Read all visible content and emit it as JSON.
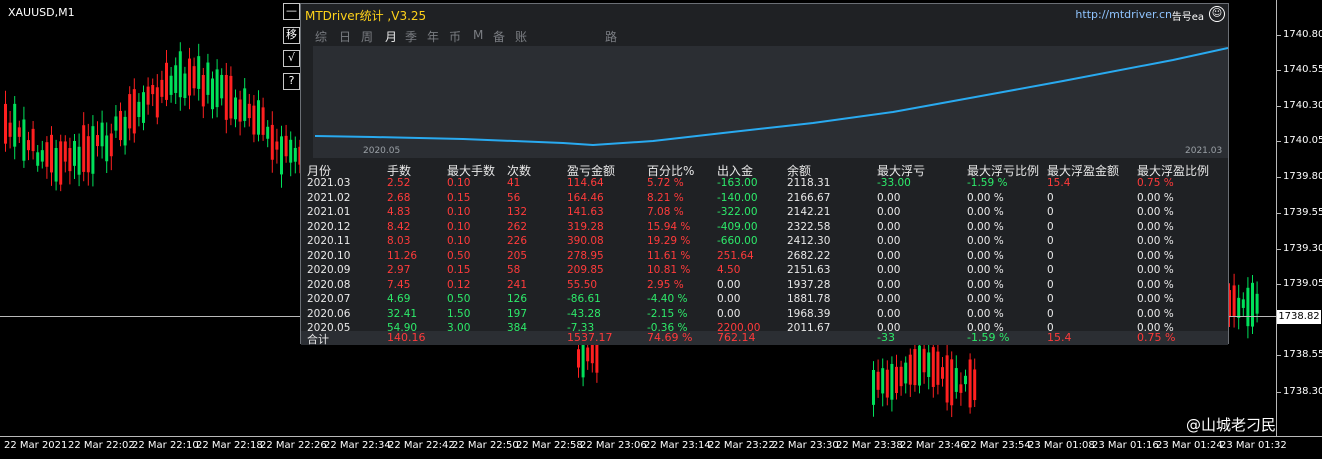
{
  "chart": {
    "symbol": "XAUUSD,M1",
    "price_ticks": [
      "1740.80",
      "1740.55",
      "1740.30",
      "1740.05",
      "1739.80",
      "1739.55",
      "1739.30",
      "1739.05",
      "1738.55",
      "1738.30"
    ],
    "current_price": "1738.82",
    "time_ticks": [
      "22 Mar 2021",
      "22 Mar 22:02",
      "22 Mar 22:10",
      "22 Mar 22:18",
      "22 Mar 22:26",
      "22 Mar 22:34",
      "22 Mar 22:42",
      "22 Mar 22:50",
      "22 Mar 22:58",
      "22 Mar 23:06",
      "22 Mar 23:14",
      "22 Mar 23:22",
      "22 Mar 23:30",
      "22 Mar 23:38",
      "22 Mar 23:46",
      "22 Mar 23:54",
      "23 Mar 01:08",
      "23 Mar 01:16",
      "23 Mar 01:24",
      "23 Mar 01:32"
    ],
    "watermark": "@山城老刁民",
    "colors": {
      "up": "#00e05a",
      "down": "#ff2020",
      "background": "#000000"
    }
  },
  "side_buttons": [
    "—",
    "移",
    "√",
    "?"
  ],
  "panel": {
    "title": "MTDriver统计 ,V3.25",
    "url": "http://mtdriver.cn",
    "extra": "告号ea",
    "close_icon": "close-icon",
    "tabs": [
      "综",
      "日",
      "周",
      "月",
      "季",
      "年",
      "币",
      "M",
      "备",
      "账户",
      "路径"
    ],
    "active_tab": "月",
    "graph": {
      "start_label": "2020.05",
      "end_label": "2021.03",
      "line_color": "#29aaf0"
    },
    "columns": [
      "月份",
      "手数",
      "最大手数",
      "次数",
      "盈亏金额",
      "百分比%",
      "出入金",
      "余额",
      "最大浮亏",
      "最大浮亏比例",
      "最大浮盈金额",
      "最大浮盈比例"
    ],
    "rows": [
      [
        "2021.03",
        "2.52",
        "0.10",
        "41",
        "114.64",
        "5.72 %",
        "-163.00",
        "2118.31",
        "-33.00",
        "-1.59 %",
        "15.4",
        "0.75 %"
      ],
      [
        "2021.02",
        "2.68",
        "0.15",
        "56",
        "164.46",
        "8.21 %",
        "-140.00",
        "2166.67",
        "0.00",
        "0.00 %",
        "0",
        "0.00 %"
      ],
      [
        "2021.01",
        "4.83",
        "0.10",
        "132",
        "141.63",
        "7.08 %",
        "-322.00",
        "2142.21",
        "0.00",
        "0.00 %",
        "0",
        "0.00 %"
      ],
      [
        "2020.12",
        "8.42",
        "0.10",
        "262",
        "319.28",
        "15.94 %",
        "-409.00",
        "2322.58",
        "0.00",
        "0.00 %",
        "0",
        "0.00 %"
      ],
      [
        "2020.11",
        "8.03",
        "0.10",
        "226",
        "390.08",
        "19.29 %",
        "-660.00",
        "2412.30",
        "0.00",
        "0.00 %",
        "0",
        "0.00 %"
      ],
      [
        "2020.10",
        "11.26",
        "0.50",
        "205",
        "278.95",
        "11.61 %",
        "251.64",
        "2682.22",
        "0.00",
        "0.00 %",
        "0",
        "0.00 %"
      ],
      [
        "2020.09",
        "2.97",
        "0.15",
        "58",
        "209.85",
        "10.81 %",
        "4.50",
        "2151.63",
        "0.00",
        "0.00 %",
        "0",
        "0.00 %"
      ],
      [
        "2020.08",
        "7.45",
        "0.12",
        "241",
        "55.50",
        "2.95 %",
        "0.00",
        "1937.28",
        "0.00",
        "0.00 %",
        "0",
        "0.00 %"
      ],
      [
        "2020.07",
        "4.69",
        "0.50",
        "126",
        "-86.61",
        "-4.40 %",
        "0.00",
        "1881.78",
        "0.00",
        "0.00 %",
        "0",
        "0.00 %"
      ],
      [
        "2020.06",
        "32.41",
        "1.50",
        "197",
        "-43.28",
        "-2.15 %",
        "0.00",
        "1968.39",
        "0.00",
        "0.00 %",
        "0",
        "0.00 %"
      ],
      [
        "2020.05",
        "54.90",
        "3.00",
        "384",
        "-7.33",
        "-0.36 %",
        "2200.00",
        "2011.67",
        "0.00",
        "0.00 %",
        "0",
        "0.00 %"
      ]
    ],
    "row_colors": [
      [
        "w",
        "r",
        "r",
        "r",
        "r",
        "r",
        "g",
        "w",
        "g",
        "g",
        "r",
        "r"
      ],
      [
        "w",
        "r",
        "r",
        "r",
        "r",
        "r",
        "g",
        "w",
        "w",
        "w",
        "w",
        "w"
      ],
      [
        "w",
        "r",
        "r",
        "r",
        "r",
        "r",
        "g",
        "w",
        "w",
        "w",
        "w",
        "w"
      ],
      [
        "w",
        "r",
        "r",
        "r",
        "r",
        "r",
        "g",
        "w",
        "w",
        "w",
        "w",
        "w"
      ],
      [
        "w",
        "r",
        "r",
        "r",
        "r",
        "r",
        "g",
        "w",
        "w",
        "w",
        "w",
        "w"
      ],
      [
        "w",
        "r",
        "r",
        "r",
        "r",
        "r",
        "r",
        "w",
        "w",
        "w",
        "w",
        "w"
      ],
      [
        "w",
        "r",
        "r",
        "r",
        "r",
        "r",
        "r",
        "w",
        "w",
        "w",
        "w",
        "w"
      ],
      [
        "w",
        "r",
        "r",
        "r",
        "r",
        "r",
        "w",
        "w",
        "w",
        "w",
        "w",
        "w"
      ],
      [
        "w",
        "g",
        "g",
        "g",
        "g",
        "g",
        "w",
        "w",
        "w",
        "w",
        "w",
        "w"
      ],
      [
        "w",
        "g",
        "g",
        "g",
        "g",
        "g",
        "w",
        "w",
        "w",
        "w",
        "w",
        "w"
      ],
      [
        "w",
        "g",
        "g",
        "g",
        "g",
        "g",
        "r",
        "w",
        "w",
        "w",
        "w",
        "w"
      ]
    ],
    "totals": {
      "label": "合计",
      "lots": "140.16",
      "profit": "1537.17",
      "percent": "74.69 %",
      "deposit": "762.14",
      "max_dd": "-33",
      "max_dd_pct": "-1.59 %",
      "max_fp": "15.4",
      "max_fp_pct": "0.75 %"
    }
  }
}
